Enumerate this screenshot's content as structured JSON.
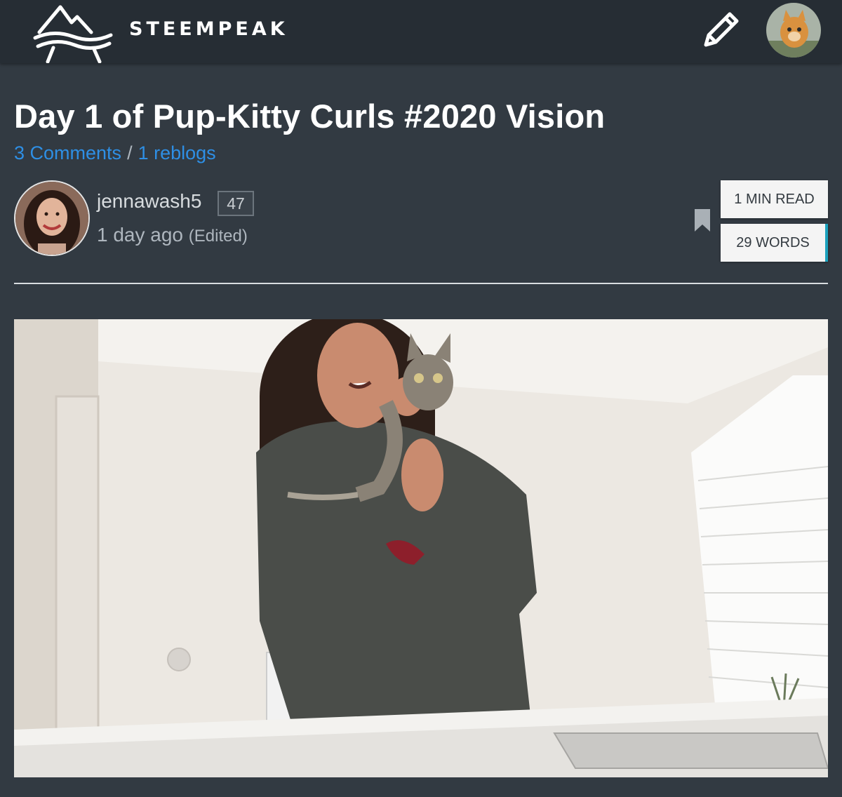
{
  "header": {
    "logo_text": "STEEMPEAK",
    "logo_icon": "mountain-logo-icon",
    "compose_icon": "pencil-icon",
    "user_avatar": "kitten-avatar"
  },
  "post": {
    "title": "Day 1 of Pup-Kitty Curls #2020 Vision",
    "comments_link": "3 Comments",
    "separator": "/",
    "reblogs_link": "1 reblogs",
    "author": {
      "name": "jennawash5",
      "reputation": "47",
      "avatar": "author-avatar"
    },
    "time_ago": "1 day ago",
    "edited": "(Edited)",
    "bookmark_icon": "bookmark-icon",
    "read_time": "1 MIN READ",
    "word_count": "29 WORDS",
    "image": "woman-holding-kitten-photo"
  },
  "colors": {
    "background": "#323a42",
    "topbar": "#262d34",
    "link": "#2e8fe5",
    "accent": "#1ba1bd"
  }
}
